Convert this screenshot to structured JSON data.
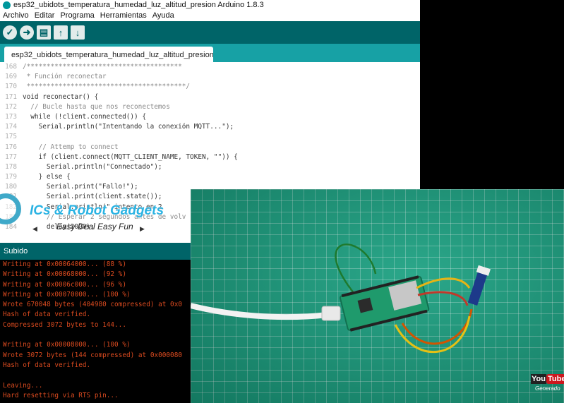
{
  "window": {
    "title": "esp32_ubidots_temperatura_humedad_luz_altitud_presion Arduino 1.8.3"
  },
  "menu": [
    "Archivo",
    "Editar",
    "Programa",
    "Herramientas",
    "Ayuda"
  ],
  "toolbar": {
    "buttons": [
      "verify-icon",
      "upload-icon",
      "new-icon",
      "open-icon",
      "save-icon"
    ]
  },
  "tab": {
    "label": "esp32_ubidots_temperatura_humedad_luz_altitud_presion"
  },
  "editor": {
    "lines": [
      {
        "num": "168",
        "text": "/***************************************"
      },
      {
        "num": "169",
        "text": " * Función reconectar"
      },
      {
        "num": "170",
        "text": " ****************************************/"
      },
      {
        "num": "171",
        "text": "void reconectar() {"
      },
      {
        "num": "172",
        "text": "  // Bucle hasta que nos reconectemos"
      },
      {
        "num": "173",
        "text": "  while (!client.connected()) {"
      },
      {
        "num": "174",
        "text": "    Serial.println(\"Intentando la conexión MQTT...\");"
      },
      {
        "num": "175",
        "text": ""
      },
      {
        "num": "176",
        "text": "    // Attemp to connect"
      },
      {
        "num": "177",
        "text": "    if (client.connect(MQTT_CLIENT_NAME, TOKEN, \"\")) {"
      },
      {
        "num": "178",
        "text": "      Serial.println(\"Connectado\");"
      },
      {
        "num": "179",
        "text": "    } else {"
      },
      {
        "num": "180",
        "text": "      Serial.print(\"Fallo!\");"
      },
      {
        "num": "181",
        "text": "      Serial.print(client.state());"
      },
      {
        "num": "182",
        "text": "      Serial.println(\" intento en 2"
      },
      {
        "num": "183",
        "text": "      // Esperar 2 segundos antes de volv"
      },
      {
        "num": "184",
        "text": "      delay(2000);"
      }
    ]
  },
  "watermark": {
    "title": "ICs & Robot Gadgets",
    "subtitle": "Easy Deal Easy Fun"
  },
  "status": {
    "text": "Subido"
  },
  "console": {
    "lines": [
      "Writing at 0x00064000... (88 %)",
      "Writing at 0x00068000... (92 %)",
      "Writing at 0x0006c000... (96 %)",
      "Writing at 0x00070000... (100 %)",
      "Wrote 670048 bytes (404980 compressed) at 0x0",
      "Hash of data verified.",
      "Compressed 3072 bytes to 144...",
      "",
      "Writing at 0x00008000... (100 %)",
      "Wrote 3072 bytes (144 compressed) at 0x000080",
      "Hash of data verified.",
      "",
      "Leaving...",
      "Hard resetting via RTS pin..."
    ]
  },
  "youtube": {
    "you": "You",
    "tube": "Tube",
    "sub": "Generado"
  },
  "colors": {
    "toolbar": "#006468",
    "tabstrip": "#17a1a5",
    "console_text": "#d94a1f",
    "board": "#1aa07f"
  }
}
